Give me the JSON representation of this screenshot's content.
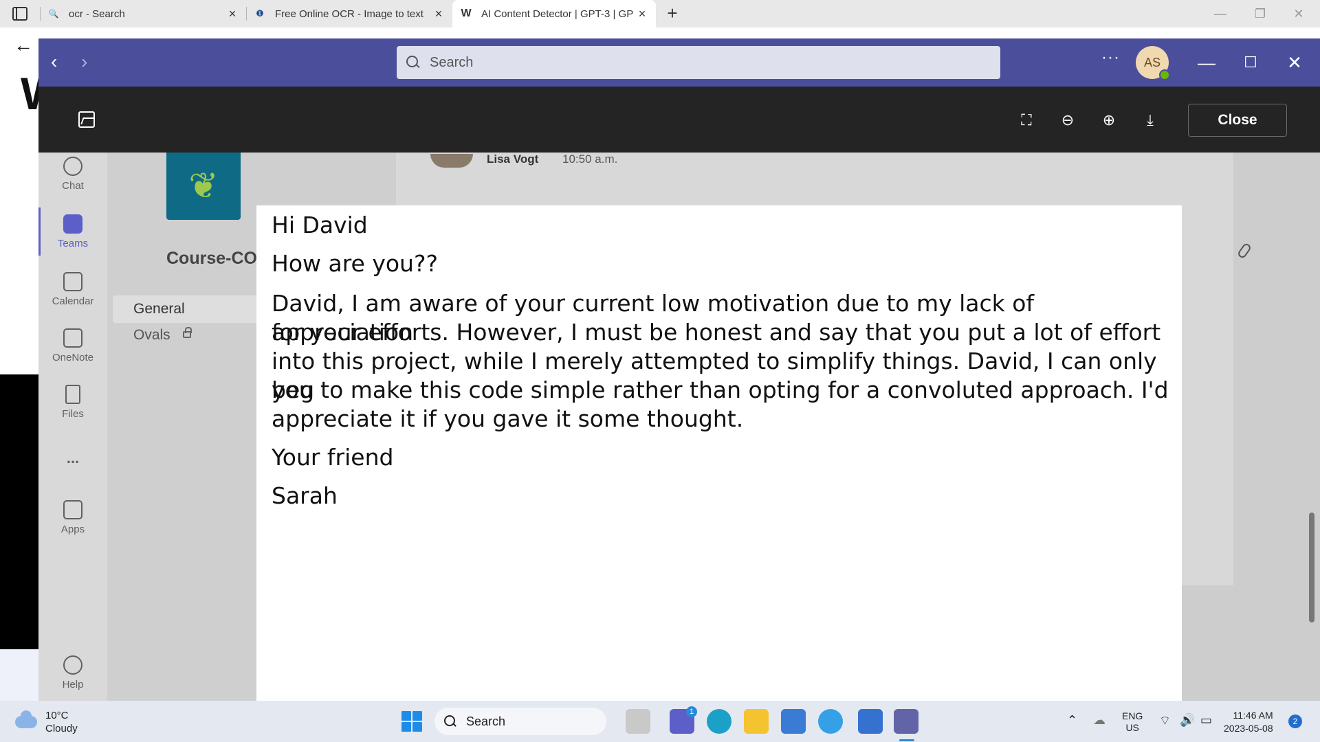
{
  "browser": {
    "tabs": [
      {
        "title": "ocr - Search",
        "favicon": "search-icon"
      },
      {
        "title": "Free Online OCR - Image to text",
        "favicon": "ocr-favicon"
      },
      {
        "title": "AI Content Detector | GPT-3 | GP",
        "favicon": "writer-favicon",
        "active": true
      }
    ],
    "favicon_glyphs": {
      "tab0": "🔍",
      "tab1": "❶",
      "tab2": "W"
    },
    "page_heading_fragment": "W"
  },
  "teams": {
    "search_placeholder": "Search",
    "avatar_initials": "AS",
    "viewer_close_label": "Close",
    "rail": [
      {
        "label": "Chat",
        "icon": "chat-icon"
      },
      {
        "label": "Teams",
        "icon": "teams-icon",
        "active": true
      },
      {
        "label": "Calendar",
        "icon": "calendar-icon"
      },
      {
        "label": "OneNote",
        "icon": "onenote-icon"
      },
      {
        "label": "Files",
        "icon": "files-icon"
      },
      {
        "label": "...",
        "icon": "more-icon"
      },
      {
        "label": "Apps",
        "icon": "apps-icon"
      },
      {
        "label": "Help",
        "icon": "help-icon"
      }
    ],
    "team_name": "Course-CO",
    "channels": [
      {
        "name": "General",
        "selected": true
      },
      {
        "name": "Ovals",
        "private": true
      }
    ],
    "message": {
      "author": "Lisa Vogt",
      "time": "10:50 a.m."
    },
    "accent_color": "#4b4f9b"
  },
  "preview_text": {
    "greeting": "Hi David",
    "question": "How are you??",
    "body_l1": "David, I am aware of your current low motivation due to my lack of appreciation",
    "body_l2": "for your efforts. However, I must be honest and say that you put a lot of effort",
    "body_l3": "into this project, while I merely attempted to simplify things. David, I can only beg",
    "body_l4": "you to make this code simple rather than opting for a convoluted approach. I'd",
    "body_l5": "appreciate it if you gave it some thought.",
    "closing": "Your friend",
    "signature": "Sarah"
  },
  "taskbar": {
    "weather_temp": "10°C",
    "weather_desc": "Cloudy",
    "search_label": "Search",
    "chat_badge": "1",
    "lang_top": "ENG",
    "lang_bottom": "US",
    "time": "11:46 AM",
    "date": "2023-05-08",
    "notification_count": "2"
  }
}
